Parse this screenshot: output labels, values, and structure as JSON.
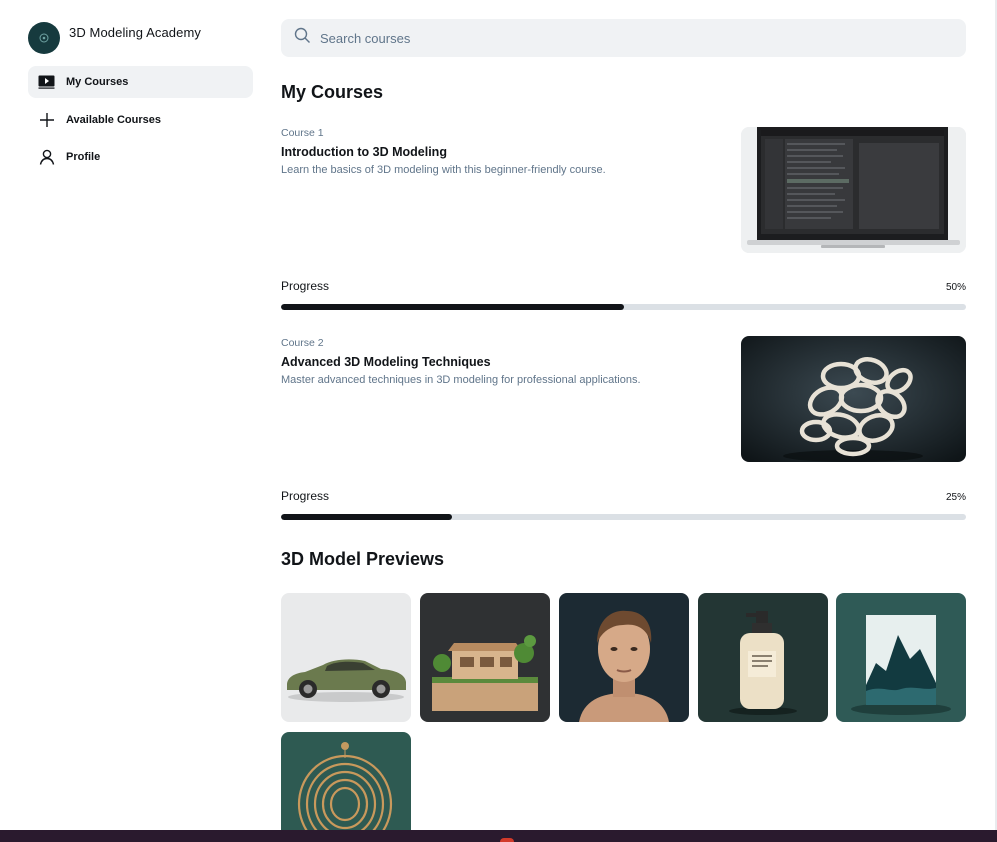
{
  "brand": {
    "name": "3D Modeling Academy"
  },
  "nav": {
    "items": [
      {
        "label": "My Courses",
        "icon": "play-icon",
        "active": true
      },
      {
        "label": "Available Courses",
        "icon": "plus-icon",
        "active": false
      },
      {
        "label": "Profile",
        "icon": "user-icon",
        "active": false
      }
    ]
  },
  "search": {
    "placeholder": "Search courses",
    "value": ""
  },
  "my_courses": {
    "title": "My Courses",
    "courses": [
      {
        "number": "Course 1",
        "title": "Introduction to 3D Modeling",
        "description": "Learn the basics of 3D modeling with this beginner-friendly course.",
        "thumbnail": "laptop-software-image",
        "progress_label": "Progress",
        "progress_text": "50%",
        "progress": 0.5
      },
      {
        "number": "Course 2",
        "title": "Advanced 3D Modeling Techniques",
        "description": "Master advanced techniques in 3D modeling for professional applications.",
        "thumbnail": "tangled-rope-sculpture-image",
        "progress_label": "Progress",
        "progress_text": "25%",
        "progress": 0.25
      }
    ]
  },
  "previews": {
    "title": "3D Model Previews",
    "items": [
      {
        "name": "car-model-preview"
      },
      {
        "name": "house-model-preview"
      },
      {
        "name": "human-head-model-preview"
      },
      {
        "name": "bottle-model-preview"
      },
      {
        "name": "mountain-sculpture-preview"
      },
      {
        "name": "spiral-sculpture-preview"
      }
    ]
  },
  "colors": {
    "accent": "#111418",
    "muted_text": "#60758a",
    "surface": "#f0f2f4",
    "track": "#dbe0e5"
  }
}
